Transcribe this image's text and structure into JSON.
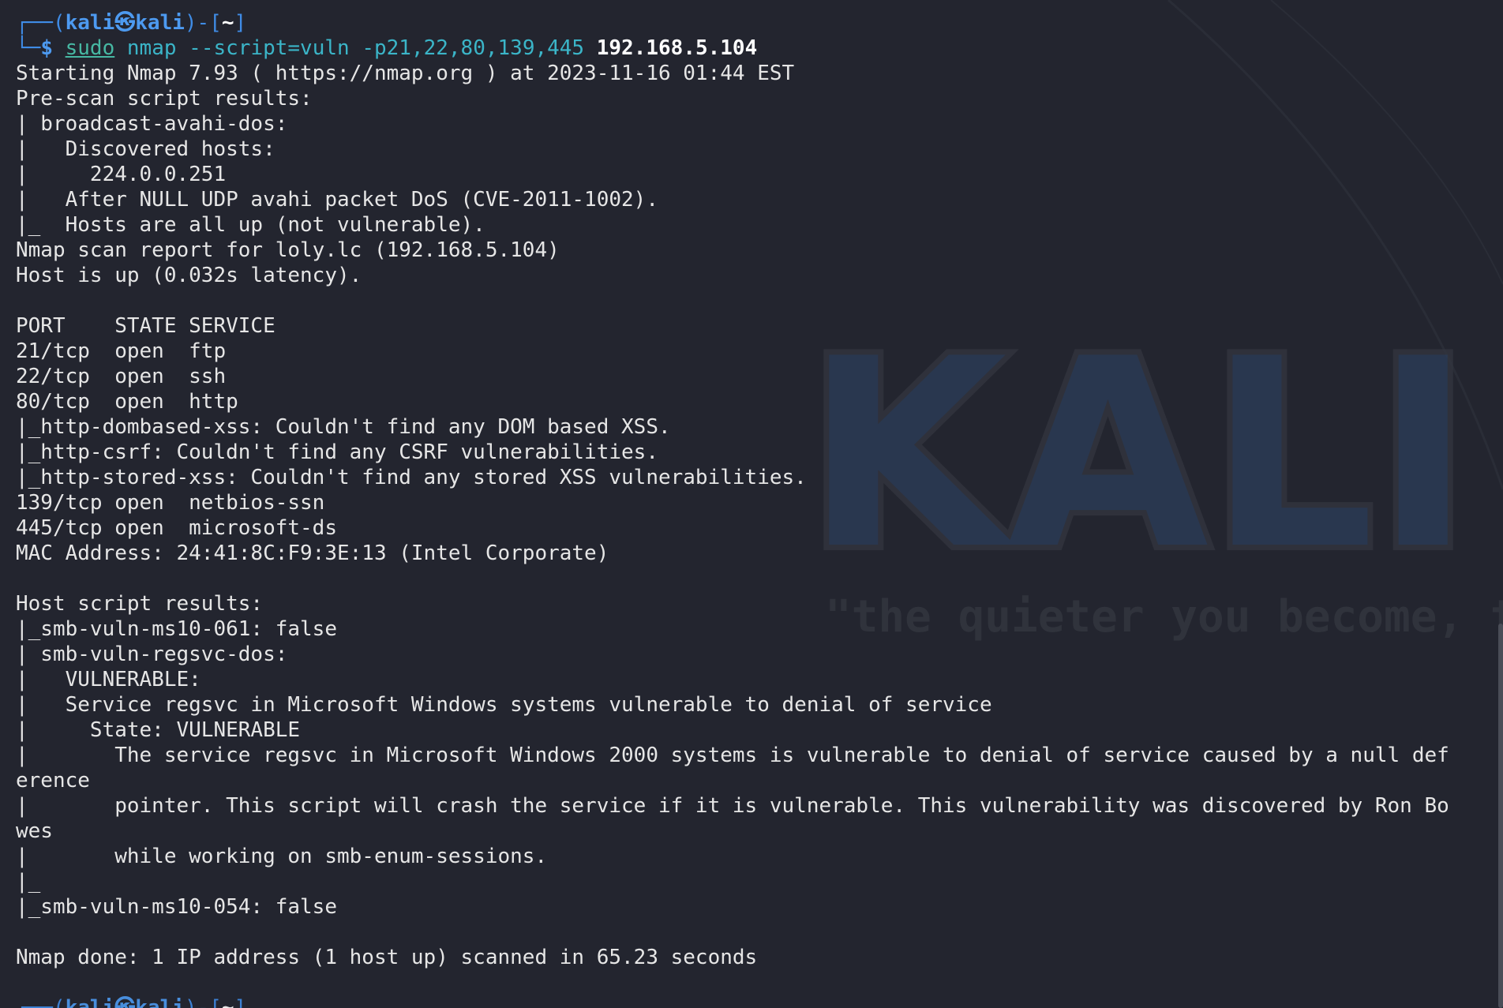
{
  "prompt": {
    "user": "kali",
    "host": "kali",
    "cwd": "~"
  },
  "command": {
    "sudo": "sudo",
    "args": "nmap --script=vuln -p21,22,80,139,445",
    "target": "192.168.5.104"
  },
  "output_lines": [
    "Starting Nmap 7.93 ( https://nmap.org ) at 2023-11-16 01:44 EST",
    "Pre-scan script results:",
    "| broadcast-avahi-dos:",
    "|   Discovered hosts:",
    "|     224.0.0.251",
    "|   After NULL UDP avahi packet DoS (CVE-2011-1002).",
    "|_  Hosts are all up (not vulnerable).",
    "Nmap scan report for loly.lc (192.168.5.104)",
    "Host is up (0.032s latency).",
    "",
    "PORT    STATE SERVICE",
    "21/tcp  open  ftp",
    "22/tcp  open  ssh",
    "80/tcp  open  http",
    "|_http-dombased-xss: Couldn't find any DOM based XSS.",
    "|_http-csrf: Couldn't find any CSRF vulnerabilities.",
    "|_http-stored-xss: Couldn't find any stored XSS vulnerabilities.",
    "139/tcp open  netbios-ssn",
    "445/tcp open  microsoft-ds",
    "MAC Address: 24:41:8C:F9:3E:13 (Intel Corporate)",
    "",
    "Host script results:",
    "|_smb-vuln-ms10-061: false",
    "| smb-vuln-regsvc-dos:",
    "|   VULNERABLE:",
    "|   Service regsvc in Microsoft Windows systems vulnerable to denial of service",
    "|     State: VULNERABLE",
    "|       The service regsvc in Microsoft Windows 2000 systems is vulnerable to denial of service caused by a null def",
    "erence",
    "|       pointer. This script will crash the service if it is vulnerable. This vulnerability was discovered by Ron Bo",
    "wes",
    "|       while working on smb-enum-sessions.",
    "|_",
    "|_smb-vuln-ms10-054: false",
    "",
    "Nmap done: 1 IP address (1 host up) scanned in 65.23 seconds",
    ""
  ],
  "wallpaper": {
    "logo_text": "KALI L",
    "tagline": "\"the quieter you become, th"
  },
  "colors": {
    "background": "#23252f",
    "prompt_blue": "#3f8ce6",
    "command_teal": "#3bb5c8",
    "text": "#e6e6e6"
  }
}
